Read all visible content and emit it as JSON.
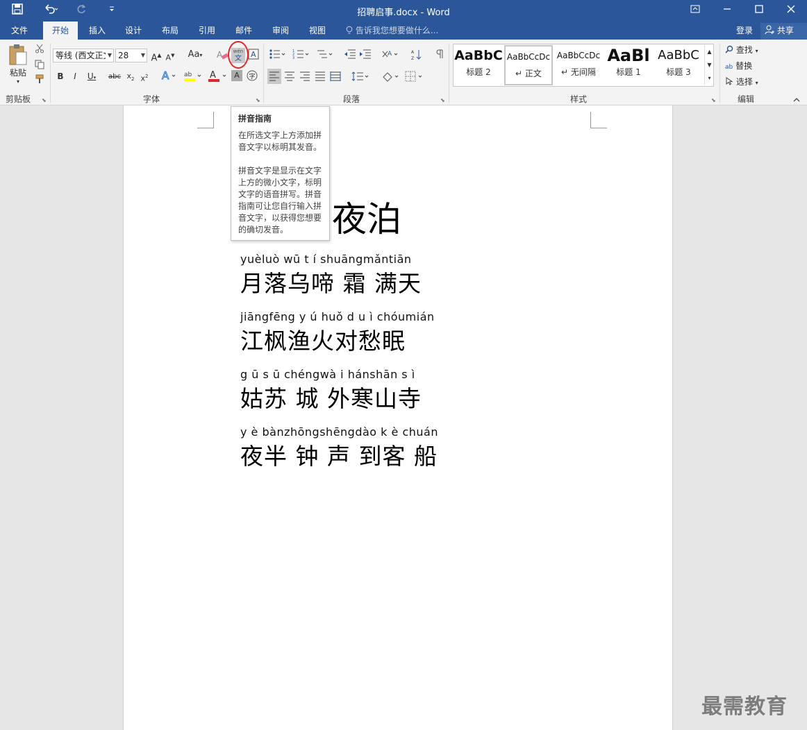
{
  "window": {
    "title": "招聘启事.docx - Word"
  },
  "tabs": [
    "文件",
    "开始",
    "插入",
    "设计",
    "布局",
    "引用",
    "邮件",
    "审阅",
    "视图"
  ],
  "tell_me": "告诉我您想要做什么...",
  "account": {
    "login": "登录",
    "share": "共享"
  },
  "ribbon": {
    "clipboard": {
      "paste": "粘贴",
      "label": "剪贴板"
    },
    "font": {
      "name": "等线 (西文正文)",
      "size": "28",
      "change_case": "Aa",
      "label": "字体",
      "phonetic_top": "wén",
      "phonetic_bottom": "文"
    },
    "paragraph": {
      "label": "段落"
    },
    "styles": {
      "label": "样式",
      "items": [
        {
          "preview": "AaBbC",
          "name": "标题 2"
        },
        {
          "preview": "AaBbCcDc",
          "name": "正文"
        },
        {
          "preview": "AaBbCcDc",
          "name": "无间隔"
        },
        {
          "preview": "AaBl",
          "name": "标题 1"
        },
        {
          "preview": "AaBbC",
          "name": "标题 3"
        }
      ]
    },
    "editing": {
      "find": "查找",
      "replace": "替换",
      "select": "选择",
      "label": "编辑"
    }
  },
  "tooltip": {
    "title": "拼音指南",
    "p1": "在所选文字上方添加拼音文字以标明其发音。",
    "p2": "拼音文字是显示在文字上方的微小文字，标明文字的语音拼写。拼音指南可让您自行输入拼音文字，以获得您想要的确切发音。"
  },
  "document": {
    "title": "夜泊",
    "lines": [
      {
        "pinyin": "yuèluò wū  t  í shuāngmǎntiān",
        "text": "月落乌啼 霜 满天"
      },
      {
        "pinyin": "jiāngfēng y  ú huǒ d u ì chóumián",
        "text": "江枫渔火对愁眠"
      },
      {
        "pinyin": "g  ū  s  ū chéngwà i hánshān s  ì",
        "text": "姑苏 城 外寒山寺"
      },
      {
        "pinyin": "y  è bànzhōngshēngdào k  è chuán",
        "text": "夜半 钟 声 到客 船"
      }
    ]
  },
  "watermark": "最需教育",
  "colors": {
    "accent": "#2b579a",
    "highlight": "#e0282a"
  }
}
